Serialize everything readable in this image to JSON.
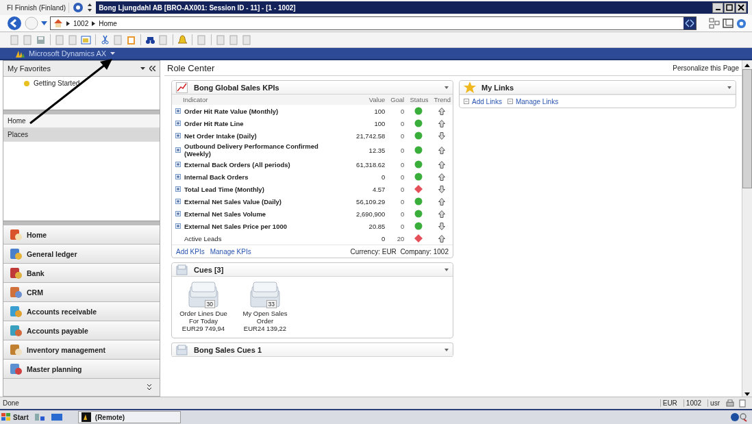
{
  "language": "FI Finnish (Finland)",
  "window": {
    "title": "Bong Ljungdahl AB [BRO-AX001: Session ID - 11] - [1 - 1002]"
  },
  "address_bar": {
    "breadcrumbs": [
      "1002",
      "Home"
    ]
  },
  "product_menu": {
    "label": "Microsoft Dynamics AX"
  },
  "favorites": {
    "title": "My Favorites",
    "items": [
      "Getting Started"
    ]
  },
  "nav_links": [
    {
      "label": "Home",
      "selected": false
    },
    {
      "label": "Places",
      "selected": true
    }
  ],
  "modules": [
    {
      "label": "Home",
      "kind": "home"
    },
    {
      "label": "General ledger",
      "kind": "ledger"
    },
    {
      "label": "Bank",
      "kind": "bank"
    },
    {
      "label": "CRM",
      "kind": "crm"
    },
    {
      "label": "Accounts receivable",
      "kind": "receivable"
    },
    {
      "label": "Accounts payable",
      "kind": "payable"
    },
    {
      "label": "Inventory management",
      "kind": "inventory"
    },
    {
      "label": "Master planning",
      "kind": "planning"
    }
  ],
  "content": {
    "title": "Role Center",
    "personalize": "Personalize this Page"
  },
  "kpi_panel": {
    "title": "Bong Global Sales KPIs",
    "columns": [
      "Indicator",
      "Value",
      "Goal",
      "Status",
      "Trend"
    ],
    "rows": [
      {
        "name": "Order Hit Rate Value (Monthly)",
        "expandable": true,
        "value": "100",
        "goal": "0",
        "status_ok": true,
        "trend_up": true
      },
      {
        "name": "Order Hit Rate Line",
        "expandable": true,
        "value": "100",
        "goal": "0",
        "status_ok": true,
        "trend_up": true
      },
      {
        "name": "Net Order Intake (Daily)",
        "expandable": true,
        "value": "21,742.58",
        "goal": "0",
        "status_ok": true,
        "trend_up": false
      },
      {
        "name": "Outbound Delivery Performance Confirmed (Weekly)",
        "expandable": true,
        "value": "12.35",
        "goal": "0",
        "status_ok": true,
        "trend_up": true
      },
      {
        "name": "External Back Orders (All periods)",
        "expandable": true,
        "value": "61,318.62",
        "goal": "0",
        "status_ok": true,
        "trend_up": true
      },
      {
        "name": "Internal Back Orders",
        "expandable": true,
        "value": "0",
        "goal": "0",
        "status_ok": true,
        "trend_up": true
      },
      {
        "name": "Total Lead Time (Monthly)",
        "expandable": true,
        "value": "4.57",
        "goal": "0",
        "status_ok": false,
        "trend_up": false
      },
      {
        "name": "External Net Sales Value (Daily)",
        "expandable": true,
        "value": "56,109.29",
        "goal": "0",
        "status_ok": true,
        "trend_up": true
      },
      {
        "name": "External Net Sales Volume",
        "expandable": true,
        "value": "2,690,900",
        "goal": "0",
        "status_ok": true,
        "trend_up": true
      },
      {
        "name": "External Net Sales Price per 1000",
        "expandable": true,
        "value": "20.85",
        "goal": "0",
        "status_ok": true,
        "trend_up": false
      },
      {
        "name": "Active Leads",
        "expandable": false,
        "value": "0",
        "goal": "20",
        "status_ok": false,
        "trend_up": true
      }
    ],
    "links": [
      "Add KPIs",
      "Manage KPIs"
    ],
    "footer": "Currency: EUR  Company: 1002"
  },
  "cues_panel": {
    "title": "Cues [3]",
    "cues": [
      {
        "count": "30",
        "label": "Order Lines Due For Today",
        "amount": "EUR29 749,94"
      },
      {
        "count": "33",
        "label": "My Open Sales Order",
        "amount": "EUR24 139,22"
      }
    ]
  },
  "bong_cues_panel": {
    "title": "Bong Sales Cues 1"
  },
  "links_panel": {
    "title": "My Links",
    "links": [
      "Add Links",
      "Manage Links"
    ]
  },
  "status_bar": {
    "text": "Done",
    "fields": [
      "EUR",
      "1002",
      "usr"
    ]
  },
  "taskbar": {
    "start": "Start",
    "tasks": [
      "(Remote)"
    ]
  }
}
